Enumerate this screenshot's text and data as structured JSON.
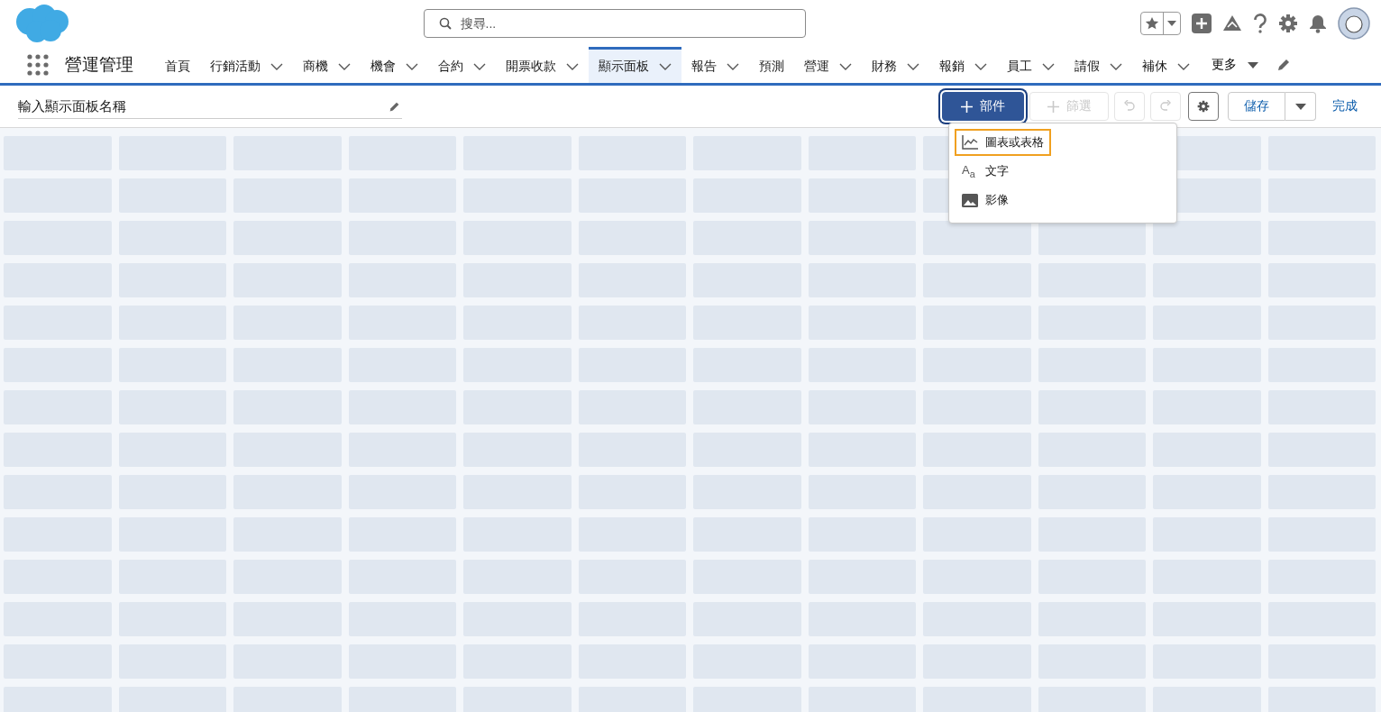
{
  "search": {
    "placeholder": "搜尋..."
  },
  "app_name": "營運管理",
  "nav_items": [
    {
      "label": "首頁",
      "dropdown": false,
      "selected": false
    },
    {
      "label": "行銷活動",
      "dropdown": true,
      "selected": false
    },
    {
      "label": "商機",
      "dropdown": true,
      "selected": false
    },
    {
      "label": "機會",
      "dropdown": true,
      "selected": false
    },
    {
      "label": "合約",
      "dropdown": true,
      "selected": false
    },
    {
      "label": "開票收款",
      "dropdown": true,
      "selected": false
    },
    {
      "label": "顯示面板",
      "dropdown": true,
      "selected": true
    },
    {
      "label": "報告",
      "dropdown": true,
      "selected": false
    },
    {
      "label": "預測",
      "dropdown": false,
      "selected": false
    },
    {
      "label": "營運",
      "dropdown": true,
      "selected": false
    },
    {
      "label": "財務",
      "dropdown": true,
      "selected": false
    },
    {
      "label": "報銷",
      "dropdown": true,
      "selected": false
    },
    {
      "label": "員工",
      "dropdown": true,
      "selected": false
    },
    {
      "label": "請假",
      "dropdown": true,
      "selected": false
    },
    {
      "label": "補休",
      "dropdown": true,
      "selected": false
    }
  ],
  "more": {
    "label": "更多"
  },
  "dashboard_name": {
    "value": "輸入顯示面板名稱"
  },
  "toolbar": [
    {
      "kind": "primary",
      "label": "部件",
      "disabled": false,
      "focused": true
    },
    {
      "kind": "plus",
      "label": "篩選",
      "disabled": true,
      "focused": false
    },
    {
      "kind": "undo",
      "disabled": true,
      "focused": false
    },
    {
      "kind": "redo",
      "disabled": true,
      "focused": false
    },
    {
      "kind": "gear",
      "disabled": false,
      "focused": false
    },
    {
      "kind": "split",
      "label": "儲存",
      "disabled": false,
      "focused": false
    },
    {
      "kind": "link",
      "label": "完成",
      "disabled": false,
      "focused": false
    }
  ],
  "menu": [
    {
      "kind": "chart",
      "label": "圖表或表格",
      "focused": true
    },
    {
      "kind": "text",
      "icon": "A$_{a}$",
      "label": "文字",
      "focused": false
    },
    {
      "kind": "image",
      "label": "影像",
      "focused": false
    }
  ]
}
